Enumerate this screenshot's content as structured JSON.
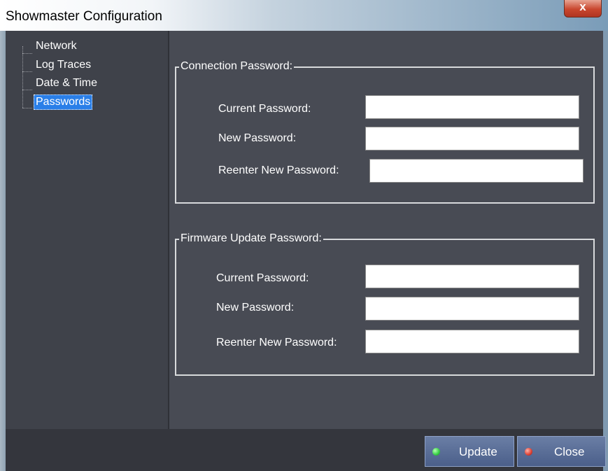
{
  "window": {
    "title": "Showmaster Configuration",
    "close_glyph": "x"
  },
  "tree": {
    "items": [
      {
        "label": "Network"
      },
      {
        "label": "Log Traces"
      },
      {
        "label": "Date & Time"
      },
      {
        "label": "Passwords",
        "selected": true
      }
    ]
  },
  "connection": {
    "legend": "Connection Password:",
    "current_label": "Current Password:",
    "new_label": "New Password:",
    "reenter_label": "Reenter New Password:"
  },
  "firmware": {
    "legend": "Firmware Update Password:",
    "current_label": "Current Password:",
    "new_label": "New Password:",
    "reenter_label": "Reenter New Password:"
  },
  "buttons": {
    "update_label": "Update",
    "close_label": "Close"
  },
  "colors": {
    "selection": "#2a7fe8",
    "update_led": "#3bd24a",
    "close_led": "#e0463a"
  }
}
